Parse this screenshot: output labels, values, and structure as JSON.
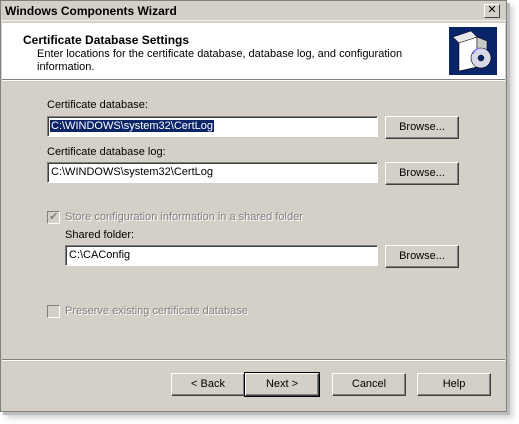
{
  "window": {
    "title": "Windows Components Wizard",
    "close_glyph": "✕"
  },
  "header": {
    "title": "Certificate Database Settings",
    "description": "Enter locations for the certificate database, database log, and configuration information."
  },
  "cert_db": {
    "label": "Certificate database:",
    "value": "C:\\WINDOWS\\system32\\CertLog",
    "browse": "Browse..."
  },
  "cert_db_log": {
    "label": "Certificate database log:",
    "value": "C:\\WINDOWS\\system32\\CertLog",
    "browse": "Browse..."
  },
  "shared": {
    "checkbox_label": "Store configuration information in a shared folder",
    "checked": true,
    "folder_label": "Shared folder:",
    "folder_value": "C:\\CAConfig",
    "browse": "Browse..."
  },
  "preserve": {
    "checkbox_label": "Preserve existing certificate database",
    "checked": false
  },
  "footer": {
    "back": "< Back",
    "next": "Next >",
    "cancel": "Cancel",
    "help": "Help"
  }
}
